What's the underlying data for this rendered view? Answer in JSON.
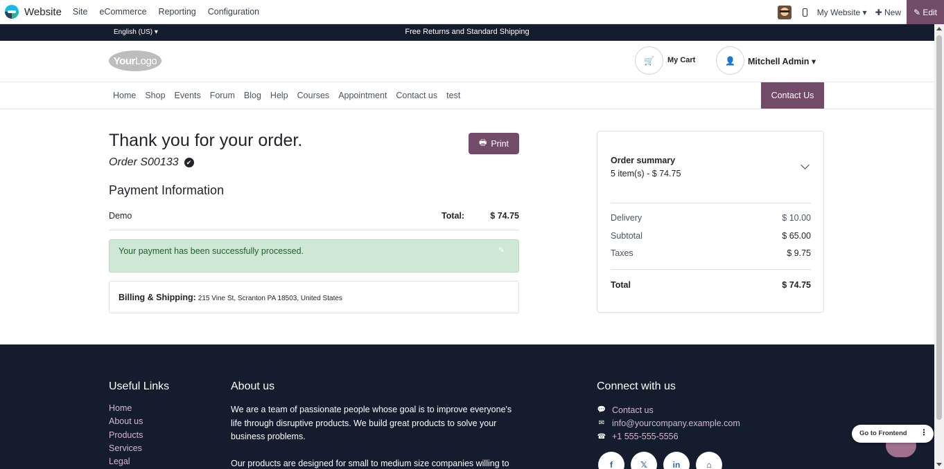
{
  "topbar": {
    "app_name": "Website",
    "menu": [
      "Site",
      "eCommerce",
      "Reporting",
      "Configuration"
    ],
    "site_select": "My Website ▾",
    "new_label": "✚ New",
    "edit_label": "✎ Edit"
  },
  "announcement": {
    "language": "English (US) ▾",
    "message": "Free Returns and Standard Shipping"
  },
  "header": {
    "logo_text_a": "Your",
    "logo_text_b": "Logo",
    "cart_label": "My Cart",
    "user_label": "Mitchell Admin ▾"
  },
  "nav": {
    "links": [
      "Home",
      "Shop",
      "Events",
      "Forum",
      "Blog",
      "Help",
      "Courses",
      "Appointment",
      "Contact us",
      "test"
    ],
    "contact_button": "Contact Us"
  },
  "order": {
    "thanks": "Thank you for your order.",
    "order_number": "Order S00133",
    "print_label": "Print",
    "payment_title": "Payment Information",
    "payment_method": "Demo",
    "total_label": "Total:",
    "total_value": "$ 74.75",
    "success_message": "Your payment has been successfully processed.",
    "billing_label": "Billing & Shipping:",
    "billing_address": "215 Vine St, Scranton PA 18503, United States"
  },
  "summary": {
    "title": "Order summary",
    "subtitle": "5 item(s) -  $ 74.75",
    "rows": [
      {
        "label": "Delivery",
        "value": "$ 10.00"
      },
      {
        "label": "Subtotal",
        "value": "$ 65.00"
      },
      {
        "label": "Taxes",
        "value": "$ 9.75"
      }
    ],
    "total_label": "Total",
    "total_value": "$ 74.75"
  },
  "footer": {
    "useful_links_title": "Useful Links",
    "useful_links": [
      "Home",
      "About us",
      "Products",
      "Services",
      "Legal"
    ],
    "about_title": "About us",
    "about_p1": "We are a team of passionate people whose goal is to improve everyone's life through disruptive products. We build great products to solve your business problems.",
    "about_p2": "Our products are designed for small to medium size companies willing to",
    "connect_title": "Connect with us",
    "connect_contact": "Contact us",
    "connect_email": "info@yourcompany.example.com",
    "connect_phone": "+1 555-555-5556",
    "socials": [
      "f",
      "𝕏",
      "in",
      "⌂"
    ]
  },
  "go_frontend": "Go to Frontend",
  "colors": {
    "brand": "#714b67",
    "dark_bg": "#151c2e",
    "success_bg": "#cfe8d5"
  }
}
